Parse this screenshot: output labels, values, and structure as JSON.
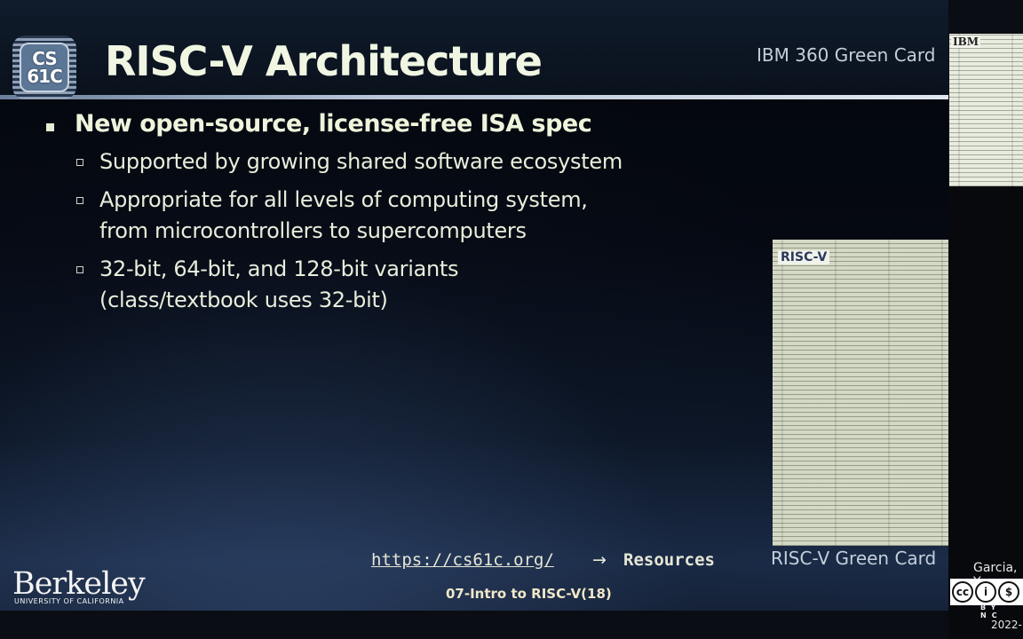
{
  "slide": {
    "title": "RISC-V Architecture",
    "logo": {
      "line1": "CS",
      "line2": "61C"
    },
    "ibm_card_label": "IBM 360 Green Card",
    "ibm_card_heading": "IBM",
    "riscv_card_label": "RISC-V Green Card",
    "riscv_card_heading": "RISC-V",
    "bullets": [
      {
        "text": "New open-source, license-free ISA spec",
        "sub": [
          {
            "lines": [
              "Supported by growing shared software ecosystem"
            ]
          },
          {
            "lines": [
              "Appropriate for all levels of computing system,",
              "from microcontrollers to supercomputers"
            ]
          },
          {
            "lines": [
              "32-bit, 64-bit, and 128-bit variants",
              "(class/textbook uses 32-bit)"
            ]
          }
        ]
      }
    ],
    "link": {
      "url": "https://cs61c.org/",
      "arrow": "→",
      "target": "Resources"
    },
    "footer": {
      "university": "Berkeley",
      "university_sub": "UNIVERSITY OF CALIFORNIA",
      "lecture": "07-Intro to RISC-V(18)"
    }
  },
  "side": {
    "author": "Garcia, Yo",
    "license": {
      "labels": [
        "cc",
        "i",
        "$",
        "="
      ],
      "sub": "BY NC"
    },
    "year": "2022-"
  }
}
